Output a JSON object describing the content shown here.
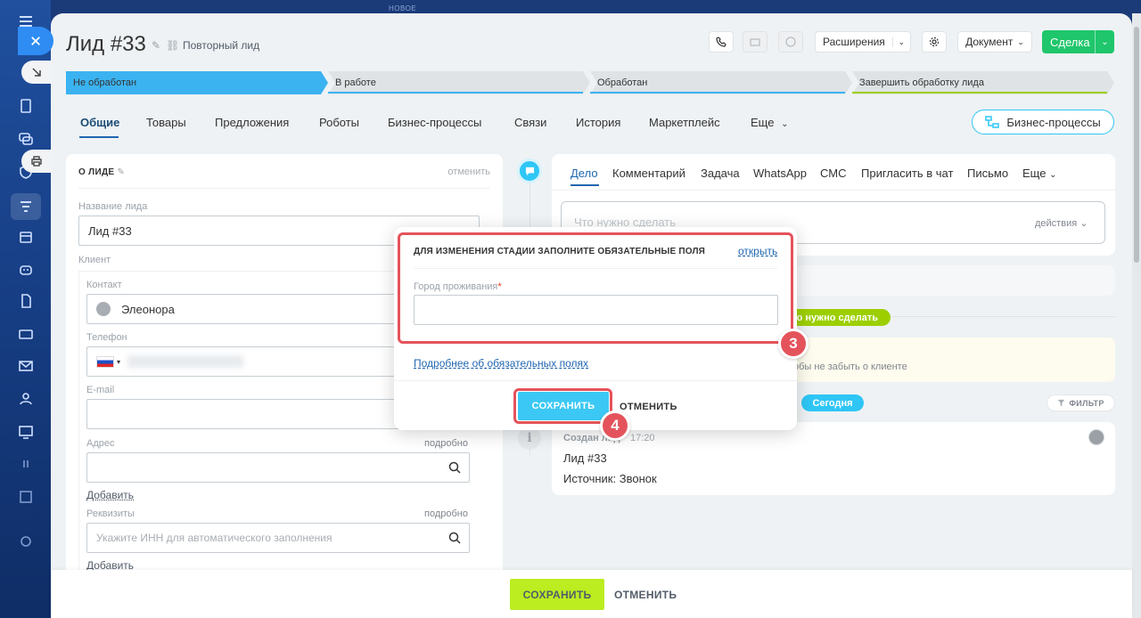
{
  "header": {
    "title": "Лид #33",
    "subtitle": "Повторный лид",
    "extensions": "Расширения",
    "document": "Документ",
    "deal": "Сделка",
    "new_tag": "НОВОЕ"
  },
  "stages": [
    {
      "label": "Не обработан",
      "color": "#3bb3f1"
    },
    {
      "label": "В работе",
      "color": "#d9dde1"
    },
    {
      "label": "Обработан",
      "color": "#d9dde1"
    },
    {
      "label": "Завершить обработку лида",
      "color": "#d9dde1"
    }
  ],
  "tabs": [
    "Общие",
    "Товары",
    "Предложения",
    "Роботы",
    "Бизнес-процессы",
    "Связи",
    "История",
    "Маркетплейс",
    "Еще"
  ],
  "bp_button": "Бизнес-процессы",
  "lead_card": {
    "heading": "О ЛИДЕ",
    "cancel": "отменить",
    "name_label": "Название лида",
    "name_value": "Лид #33",
    "client_label": "Клиент",
    "contact_label": "Контакт",
    "contact_value": "Элеонора",
    "phone_label": "Телефон",
    "email_label": "E-mail",
    "address_label": "Адрес",
    "address_more": "подробно",
    "add1": "Добавить",
    "requisites_label": "Реквизиты",
    "requisites_more": "подробно",
    "requisites_placeholder": "Укажите ИНН для автоматического заполнения",
    "add2": "Добавить"
  },
  "activity": {
    "tabs": [
      "Дело",
      "Комментарий",
      "Задача",
      "WhatsApp",
      "СМС",
      "Пригласить в чат",
      "Письмо",
      "Еще"
    ],
    "todo_placeholder": "Что нужно сделать",
    "actions": "действия",
    "green_pill": "о нужно сделать",
    "yellow_text": "обы не забыть о клиенте",
    "today": "Сегодня",
    "filter": "ФИЛЬТР",
    "event_title": "Создан лид",
    "event_time": "17:20",
    "event_line1": "Лид #33",
    "event_line2": "Источник: Звонок"
  },
  "popup": {
    "heading": "ДЛЯ ИЗМЕНЕНИЯ СТАДИИ ЗАПОЛНИТЕ ОБЯЗАТЕЛЬНЫЕ ПОЛЯ",
    "open": "открыть",
    "field_label": "Город проживания",
    "required_mark": "*",
    "more_link": "Подробнее об обязательных полях",
    "save": "СОХРАНИТЬ",
    "cancel": "ОТМЕНИТЬ"
  },
  "bottom": {
    "save": "СОХРАНИТЬ",
    "cancel": "ОТМЕНИТЬ"
  },
  "callouts": [
    "3",
    "4"
  ]
}
